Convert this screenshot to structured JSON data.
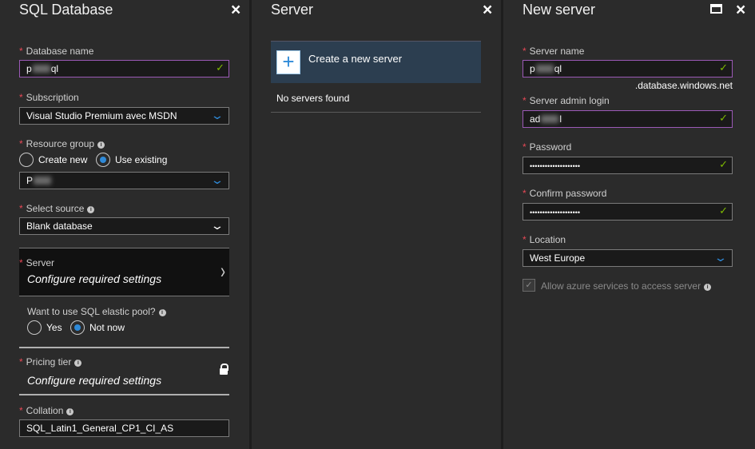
{
  "blade1": {
    "title": "SQL Database",
    "database_name": {
      "label": "Database name",
      "value_start": "p",
      "value_end": "ql"
    },
    "subscription": {
      "label": "Subscription",
      "value": "Visual Studio Premium avec MSDN"
    },
    "resource_group": {
      "label": "Resource group",
      "create_new": "Create new",
      "use_existing": "Use existing",
      "value_start": "P"
    },
    "select_source": {
      "label": "Select source",
      "value": "Blank database"
    },
    "server": {
      "label": "Server",
      "value": "Configure required settings"
    },
    "elastic_pool": {
      "label": "Want to use SQL elastic pool?",
      "yes": "Yes",
      "not_now": "Not now"
    },
    "pricing_tier": {
      "label": "Pricing tier",
      "value": "Configure required settings"
    },
    "collation": {
      "label": "Collation",
      "value": "SQL_Latin1_General_CP1_CI_AS"
    }
  },
  "blade2": {
    "title": "Server",
    "create_label": "Create a new server",
    "no_servers": "No servers found"
  },
  "blade3": {
    "title": "New server",
    "server_name": {
      "label": "Server name",
      "value_start": "p",
      "value_end": "ql",
      "suffix": ".database.windows.net"
    },
    "admin_login": {
      "label": "Server admin login",
      "value_start": "ad",
      "value_end": "l"
    },
    "password": {
      "label": "Password",
      "mask": "••••••••••••••••••••"
    },
    "confirm_password": {
      "label": "Confirm password",
      "mask": "••••••••••••••••••••"
    },
    "location": {
      "label": "Location",
      "value": "West Europe"
    },
    "allow_azure": {
      "label": "Allow azure services to access server"
    }
  },
  "icons": {
    "close": "×",
    "check": "✓",
    "info": "i",
    "chevron_down": "⌄",
    "chevron_right": "›",
    "plus": "+"
  },
  "colors": {
    "accent_blue": "#2f8ad8",
    "check_green": "#7fba00",
    "required_red": "#e74856",
    "active_border": "#9b59b6"
  }
}
